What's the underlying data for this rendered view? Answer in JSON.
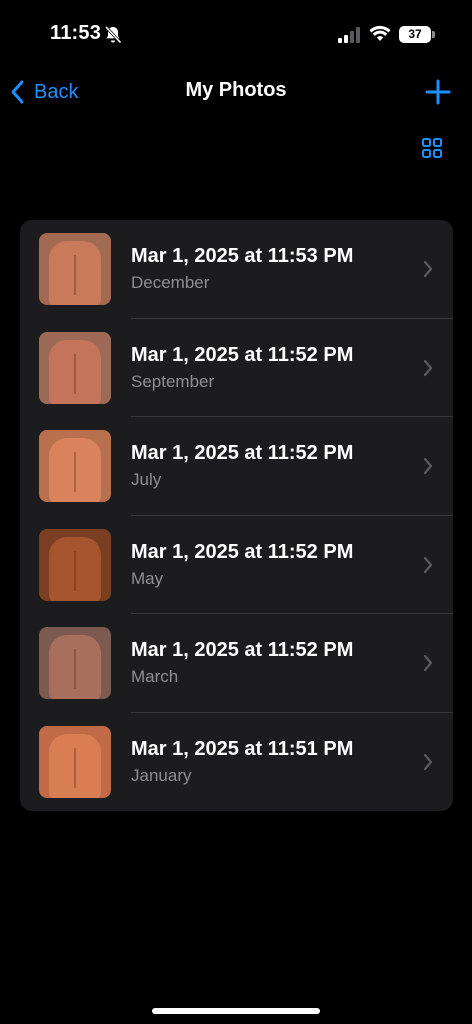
{
  "status_bar": {
    "time": "11:53",
    "battery": "37",
    "icons": [
      "bell-slash-icon",
      "cellular-signal-icon",
      "wifi-icon",
      "battery-icon"
    ]
  },
  "nav": {
    "back_label": "Back",
    "title": "My Photos",
    "icons": [
      "chevron-left-icon",
      "plus-icon",
      "grid-icon"
    ]
  },
  "colors": {
    "accent": "#1f8fff",
    "background": "#000000",
    "card": "#1c1c1e",
    "secondary_text": "#8e8e93"
  },
  "photos": [
    {
      "title": "Mar 1, 2025 at 11:53 PM",
      "subtitle": "December",
      "thumb_color": "#c97a5a",
      "thumb_bg": "#a36a52"
    },
    {
      "title": "Mar 1, 2025 at 11:52 PM",
      "subtitle": "September",
      "thumb_color": "#c4745a",
      "thumb_bg": "#9e6a58"
    },
    {
      "title": "Mar 1, 2025 at 11:52 PM",
      "subtitle": "July",
      "thumb_color": "#d9825c",
      "thumb_bg": "#b9704f"
    },
    {
      "title": "Mar 1, 2025 at 11:52 PM",
      "subtitle": "May",
      "thumb_color": "#a6552e",
      "thumb_bg": "#7a3e22"
    },
    {
      "title": "Mar 1, 2025 at 11:52 PM",
      "subtitle": "March",
      "thumb_color": "#a8705c",
      "thumb_bg": "#7d5a4f"
    },
    {
      "title": "Mar 1, 2025 at 11:51 PM",
      "subtitle": "January",
      "thumb_color": "#d97d55",
      "thumb_bg": "#c06a48"
    }
  ]
}
